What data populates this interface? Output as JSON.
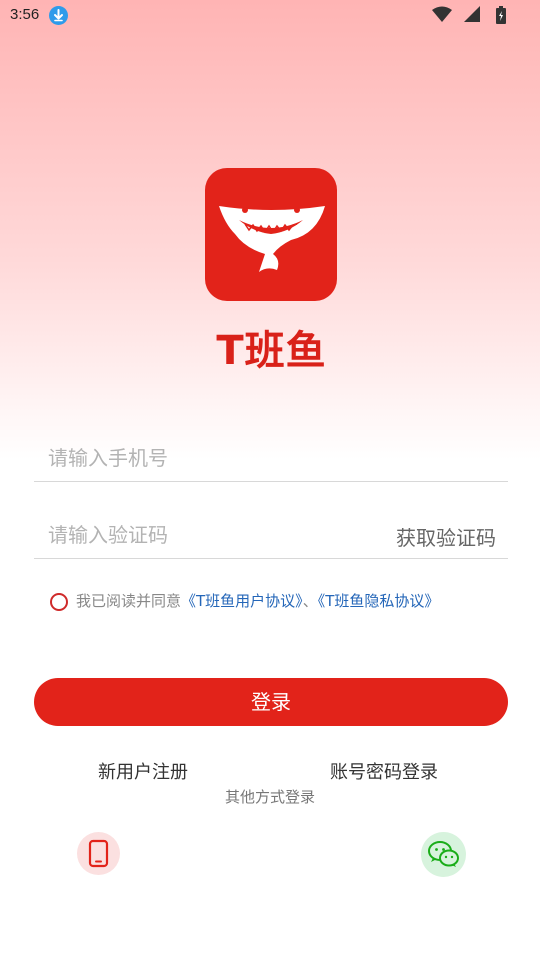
{
  "status_bar": {
    "time": "3:56",
    "icons": [
      "download-icon",
      "wifi-icon",
      "signal-icon",
      "battery-icon"
    ]
  },
  "brand": {
    "name": "T班鱼",
    "logo_icon": "shark-logo-icon",
    "color": "#e2231a"
  },
  "form": {
    "phone_placeholder": "请输入手机号",
    "phone_value": "",
    "code_placeholder": "请输入验证码",
    "code_value": "",
    "get_code_label": "获取验证码"
  },
  "agreement": {
    "checked": false,
    "prefix": "我已阅读并同意",
    "user_agreement": "《T班鱼用户协议》",
    "separator": "、",
    "privacy_policy": "《T班鱼隐私协议》",
    "link_color": "#2466b8"
  },
  "actions": {
    "login_label": "登录",
    "register_label": "新用户注册",
    "password_login_label": "账号密码登录",
    "other_methods_label": "其他方式登录"
  },
  "other_logins": [
    {
      "name": "phone-icon",
      "color": "#e2231a"
    },
    {
      "name": "wechat-icon",
      "color": "#1aad19"
    }
  ]
}
